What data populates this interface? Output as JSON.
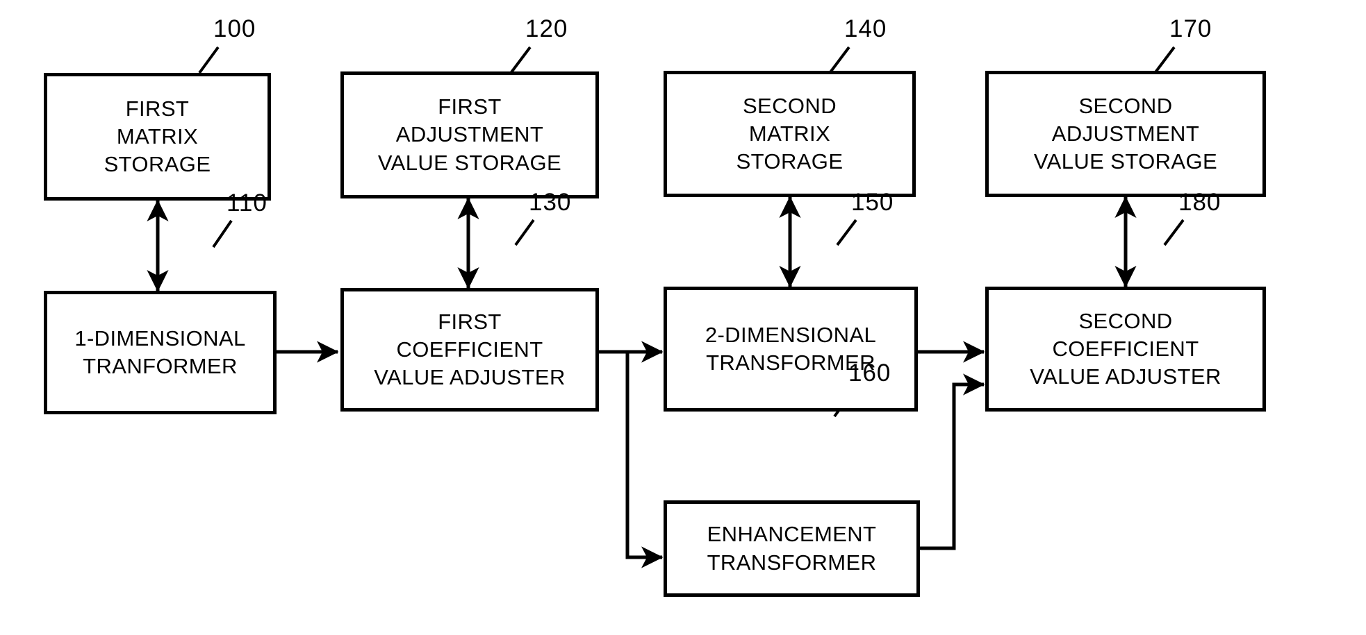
{
  "figure": {
    "type": "block-diagram",
    "background_color": "#ffffff",
    "line_color": "#000000",
    "blocks": [
      {
        "ref": "100",
        "label": "FIRST\nMATRIX\nSTORAGE",
        "name": "first-matrix-storage"
      },
      {
        "ref": "110",
        "label": "1-DIMENSIONAL\nTRANFORMER",
        "name": "one-dimensional-tranformer"
      },
      {
        "ref": "120",
        "label": "FIRST\nADJUSTMENT\nVALUE STORAGE",
        "name": "first-adjustment-value-storage"
      },
      {
        "ref": "130",
        "label": "FIRST\nCOEFFICIENT\nVALUE ADJUSTER",
        "name": "first-coefficient-value-adjuster"
      },
      {
        "ref": "140",
        "label": "SECOND\nMATRIX\nSTORAGE",
        "name": "second-matrix-storage"
      },
      {
        "ref": "150",
        "label": "2-DIMENSIONAL\nTRANSFORMER",
        "name": "two-dimensional-transformer"
      },
      {
        "ref": "160",
        "label": "ENHANCEMENT\nTRANSFORMER",
        "name": "enhancement-transformer"
      },
      {
        "ref": "170",
        "label": "SECOND\nADJUSTMENT\nVALUE STORAGE",
        "name": "second-adjustment-value-storage"
      },
      {
        "ref": "180",
        "label": "SECOND\nCOEFFICIENT\nVALUE ADJUSTER",
        "name": "second-coefficient-value-adjuster"
      }
    ],
    "connections": [
      {
        "from": "100",
        "to": "110",
        "style": "double-arrow-vertical"
      },
      {
        "from": "120",
        "to": "130",
        "style": "double-arrow-vertical"
      },
      {
        "from": "140",
        "to": "150",
        "style": "double-arrow-vertical"
      },
      {
        "from": "170",
        "to": "180",
        "style": "double-arrow-vertical"
      },
      {
        "from": "110",
        "to": "130",
        "style": "arrow-right"
      },
      {
        "from": "130",
        "to": "150",
        "style": "arrow-right"
      },
      {
        "from": "130",
        "to": "160",
        "style": "branch-down-then-right"
      },
      {
        "from": "150",
        "to": "180",
        "style": "arrow-right"
      },
      {
        "from": "160",
        "to": "180",
        "style": "right-up-then-right"
      }
    ]
  }
}
